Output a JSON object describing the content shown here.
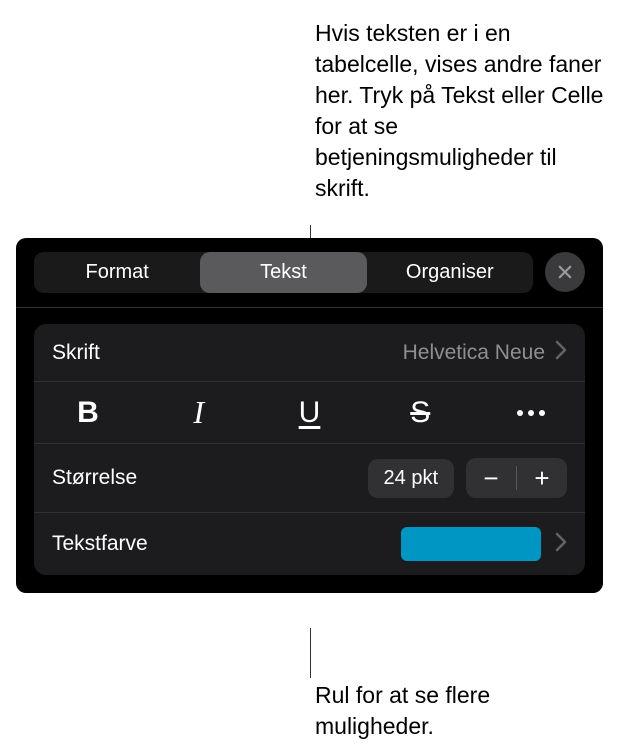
{
  "callouts": {
    "top": "Hvis teksten er i en tabelcelle, vises andre faner her. Tryk på Tekst eller Celle for at se betjeningsmuligheder til skrift.",
    "bottom": "Rul for at se flere muligheder."
  },
  "tabs": {
    "format": "Format",
    "tekst": "Tekst",
    "organiser": "Organiser"
  },
  "font": {
    "label": "Skrift",
    "value": "Helvetica Neue"
  },
  "styles": {
    "bold": "B",
    "italic": "I",
    "underline": "U",
    "strike": "S"
  },
  "size": {
    "label": "Størrelse",
    "value": "24 pkt"
  },
  "textcolor": {
    "label": "Tekstfarve",
    "swatch": "#0096c4"
  }
}
